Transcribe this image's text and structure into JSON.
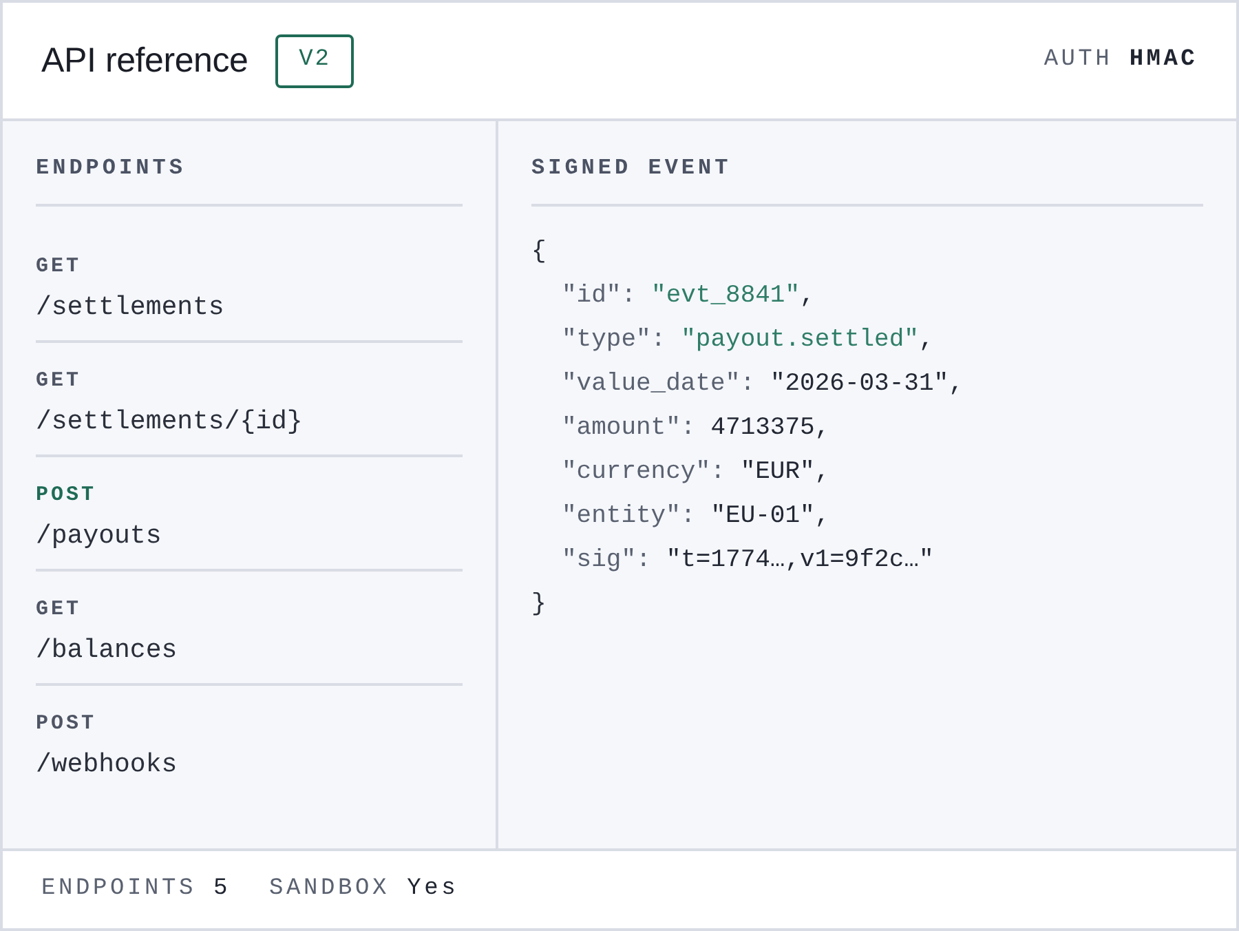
{
  "header": {
    "title": "API reference",
    "version_badge": "V2",
    "auth_label": "AUTH",
    "auth_value": "HMAC"
  },
  "endpoints_panel": {
    "heading": "ENDPOINTS",
    "items": [
      {
        "method": "GET",
        "path": "/settlements",
        "selected": false
      },
      {
        "method": "GET",
        "path": "/settlements/{id}",
        "selected": false
      },
      {
        "method": "POST",
        "path": "/payouts",
        "selected": true
      },
      {
        "method": "GET",
        "path": "/balances",
        "selected": false
      },
      {
        "method": "POST",
        "path": "/webhooks",
        "selected": false
      }
    ]
  },
  "event_panel": {
    "heading": "SIGNED EVENT",
    "open_brace": "{",
    "fields": [
      {
        "key": "\"id\":",
        "value": "\"evt_8841\"",
        "highlighted": true,
        "trail": ","
      },
      {
        "key": "\"type\":",
        "value": "\"payout.settled\"",
        "highlighted": true,
        "trail": ","
      },
      {
        "key": "\"value_date\":",
        "value": "\"2026-03-31\"",
        "highlighted": false,
        "trail": ","
      },
      {
        "key": "\"amount\":",
        "value": "4713375",
        "highlighted": false,
        "trail": ","
      },
      {
        "key": "\"currency\":",
        "value": "\"EUR\"",
        "highlighted": false,
        "trail": ","
      },
      {
        "key": "\"entity\":",
        "value": "\"EU-01\"",
        "highlighted": false,
        "trail": ","
      },
      {
        "key": "\"sig\":",
        "value": "\"t=1774…,v1=9f2c…\"",
        "highlighted": false
      }
    ],
    "close_brace": "}"
  },
  "status_bar": [
    {
      "label": "ENDPOINTS",
      "value": "5"
    },
    {
      "label": "SANDBOX",
      "value": "Yes"
    }
  ]
}
